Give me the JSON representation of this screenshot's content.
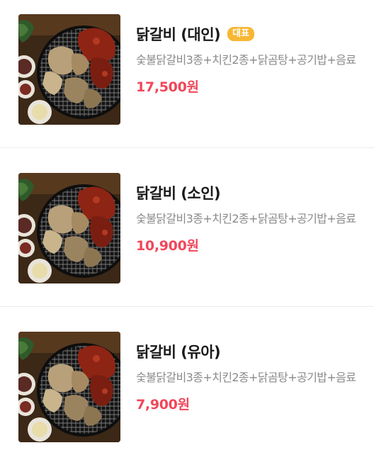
{
  "menu": {
    "items": [
      {
        "name": "닭갈비 (대인)",
        "badge": "대표",
        "description": "숯불닭갈비3종+치킨2종+닭곰탕+공기밥+음료",
        "price": "17,500원",
        "image_icon": "grilled-chicken-dish-icon"
      },
      {
        "name": "닭갈비 (소인)",
        "description": "숯불닭갈비3종+치킨2종+닭곰탕+공기밥+음료",
        "price": "10,900원",
        "image_icon": "grilled-chicken-dish-icon"
      },
      {
        "name": "닭갈비 (유아)",
        "description": "숯불닭갈비3종+치킨2종+닭곰탕+공기밥+음료",
        "price": "7,900원",
        "image_icon": "grilled-chicken-dish-icon"
      }
    ]
  },
  "colors": {
    "badge": "#f7b733",
    "price": "#f0475a",
    "name": "#1a1a1a",
    "description": "#8a8a8a"
  }
}
